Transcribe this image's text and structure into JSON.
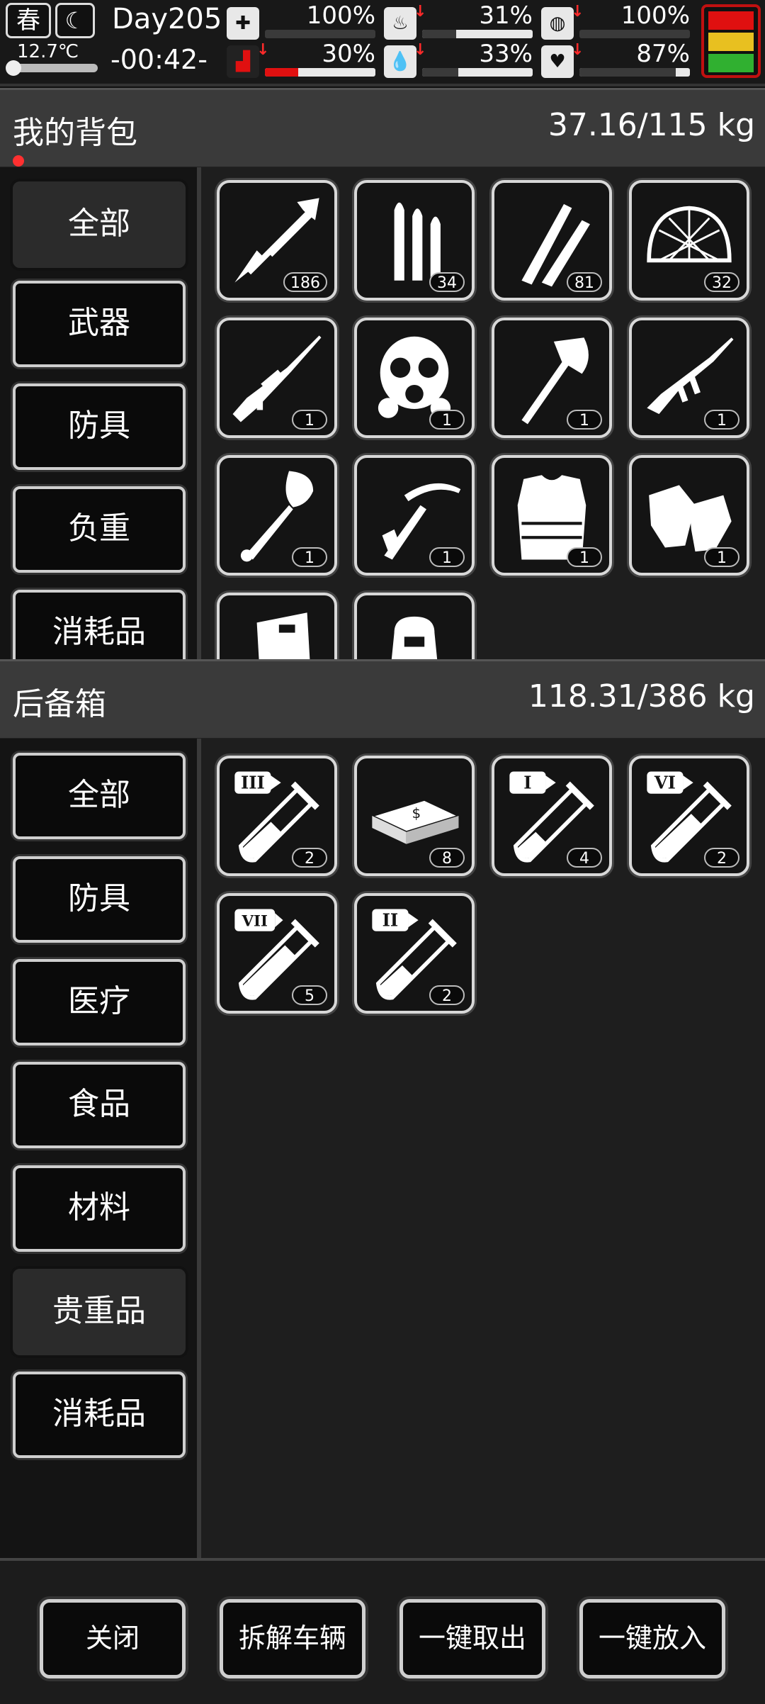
{
  "status": {
    "season": "春",
    "temperature": "12.7℃",
    "day": "Day205",
    "clock": "-00:42-",
    "stats": [
      {
        "name": "health",
        "icon": "medkit-icon",
        "value": "100%",
        "level": 1.0,
        "down": false
      },
      {
        "name": "hunger",
        "icon": "stomach-icon",
        "value": "31%",
        "level": 0.31,
        "down": true
      },
      {
        "name": "sanity",
        "icon": "pill-icon",
        "value": "100%",
        "level": 1.0,
        "down": true
      },
      {
        "name": "stamina",
        "icon": "boot-icon",
        "value": "30%",
        "level": 0.3,
        "down": true
      },
      {
        "name": "thirst",
        "icon": "water-drop-icon",
        "value": "33%",
        "level": 0.33,
        "down": true
      },
      {
        "name": "mood",
        "icon": "heart-icon",
        "value": "87%",
        "level": 0.87,
        "down": true
      }
    ],
    "colors": {
      "danger": "#e01010",
      "warn": "#e8c020",
      "ok": "#30b030"
    }
  },
  "backpack": {
    "title": "我的背包",
    "weight": "37.16/115 kg",
    "categories": [
      "全部",
      "武器",
      "防具",
      "负重",
      "消耗品"
    ],
    "selected": 0,
    "items": [
      {
        "icon": "arrow-icon",
        "count": "186"
      },
      {
        "icon": "rifle-bullets-icon",
        "count": "34"
      },
      {
        "icon": "bullets-icon",
        "count": "81"
      },
      {
        "icon": "net-helmet-icon",
        "count": "32"
      },
      {
        "icon": "sniper-rifle-icon",
        "count": "1"
      },
      {
        "icon": "gas-mask-icon",
        "count": "1"
      },
      {
        "icon": "axe-icon",
        "count": "1"
      },
      {
        "icon": "assault-rifle-icon",
        "count": "1"
      },
      {
        "icon": "shovel-icon",
        "count": "1"
      },
      {
        "icon": "crossbow-icon",
        "count": "1"
      },
      {
        "icon": "body-armor-icon",
        "count": "1"
      },
      {
        "icon": "gloves-icon",
        "count": "1"
      },
      {
        "icon": "riot-shield-icon",
        "count": ""
      },
      {
        "icon": "backpack-icon",
        "count": ""
      }
    ]
  },
  "trunk": {
    "title": "后备箱",
    "weight": "118.31/386 kg",
    "categories": [
      "全部",
      "防具",
      "医疗",
      "食品",
      "材料",
      "贵重品",
      "消耗品"
    ],
    "selected": 5,
    "items": [
      {
        "icon": "test-tube-icon",
        "tier": "III",
        "count": "2"
      },
      {
        "icon": "cash-bundle-icon",
        "tier": "",
        "count": "8"
      },
      {
        "icon": "test-tube-icon",
        "tier": "I",
        "count": "4"
      },
      {
        "icon": "test-tube-icon",
        "tier": "VI",
        "count": "2"
      },
      {
        "icon": "test-tube-icon",
        "tier": "VII",
        "count": "5"
      },
      {
        "icon": "test-tube-icon",
        "tier": "II",
        "count": "2"
      }
    ]
  },
  "buttons": [
    "关闭",
    "拆解车辆",
    "一键取出",
    "一键放入"
  ]
}
